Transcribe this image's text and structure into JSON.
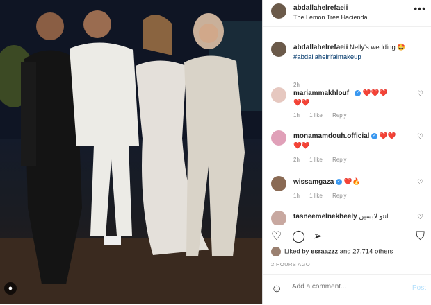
{
  "post": {
    "author": "abdallahelrefaeii",
    "location": "The Lemon Tree Hacienda",
    "caption_text": "Nelly's wedding 🤩",
    "caption_tag": "#abdallahelrifaimakeup",
    "caption_age": "2h"
  },
  "comments": [
    {
      "user": "mariammakhlouf_",
      "text": "❤️❤️❤️",
      "text2": "❤️❤️",
      "age": "1h",
      "likes": "1 like",
      "reply": "Reply",
      "verified": true
    },
    {
      "user": "monamamdouh.official",
      "text": "❤️❤️",
      "text2": "❤️❤️",
      "age": "2h",
      "likes": "1 like",
      "reply": "Reply",
      "verified": true
    },
    {
      "user": "wissamgaza",
      "text": "❤️🔥",
      "text2": "",
      "age": "1h",
      "likes": "1 like",
      "reply": "Reply",
      "verified": true
    },
    {
      "user": "tasneemelnekheely",
      "text": "انتو لابسين",
      "text2": "",
      "age": "",
      "likes": "",
      "reply": "",
      "verified": false
    }
  ],
  "actions": {
    "liked_by_prefix": "Liked by",
    "liked_by_user": "esraazzz",
    "liked_by_suffix": "and 27,714 others",
    "time_ago": "2 HOURS AGO"
  },
  "composer": {
    "placeholder": "Add a comment...",
    "post_label": "Post"
  },
  "colors": {
    "verified": "#3897f0",
    "link": "#00376b",
    "post_disabled": "#b2dffc"
  }
}
